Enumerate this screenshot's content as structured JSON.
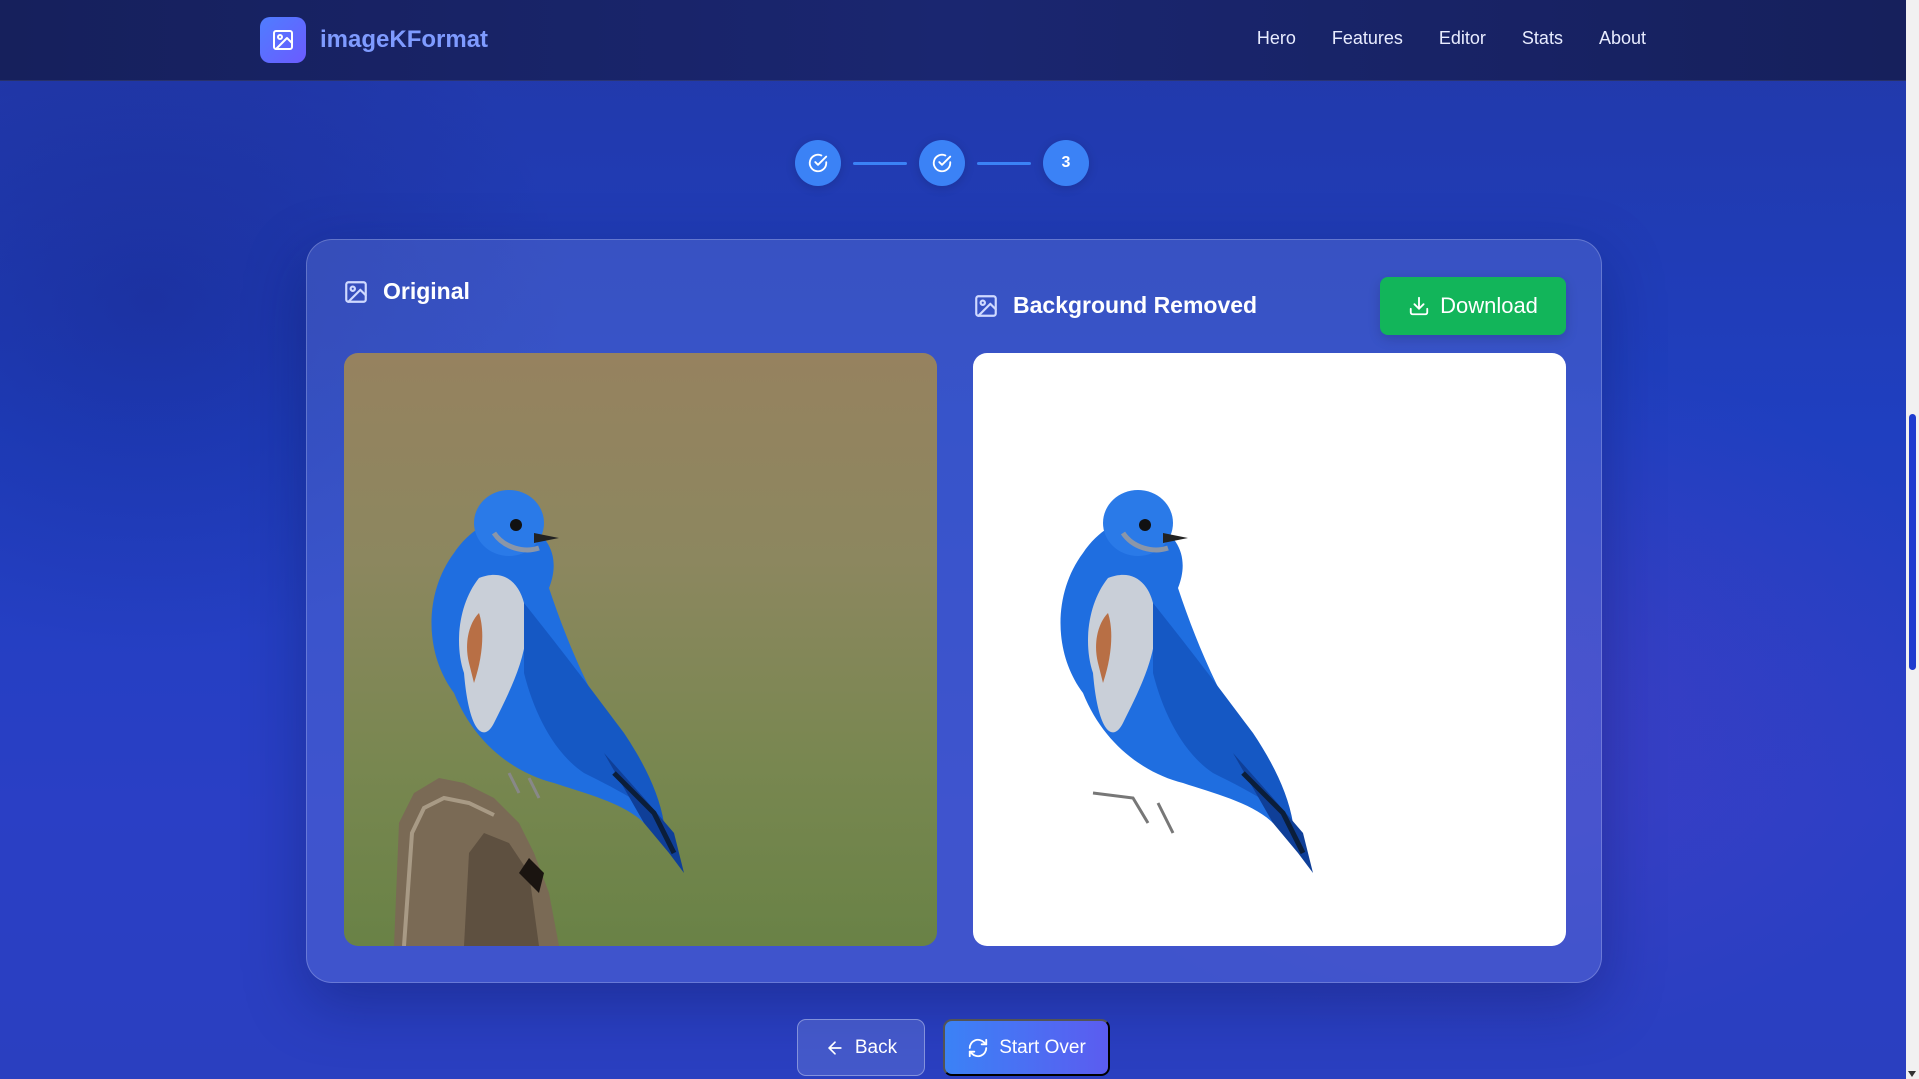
{
  "brand": {
    "name": "imageKFormat",
    "icon": "image-icon"
  },
  "nav": {
    "items": [
      "Hero",
      "Features",
      "Editor",
      "Stats",
      "About"
    ]
  },
  "steps": [
    {
      "state": "done",
      "icon": "check-circle-icon",
      "label": ""
    },
    {
      "state": "done",
      "icon": "check-circle-icon",
      "label": ""
    },
    {
      "state": "current",
      "label": "3"
    }
  ],
  "panels": {
    "original": {
      "title": "Original",
      "icon": "image-icon"
    },
    "removed": {
      "title": "Background Removed",
      "icon": "image-icon"
    }
  },
  "actions": {
    "download": "Download",
    "back": "Back",
    "start_over": "Start Over"
  },
  "colors": {
    "accent": "#3b82f6",
    "download": "#12b55a",
    "background": "#1f3fc0"
  }
}
